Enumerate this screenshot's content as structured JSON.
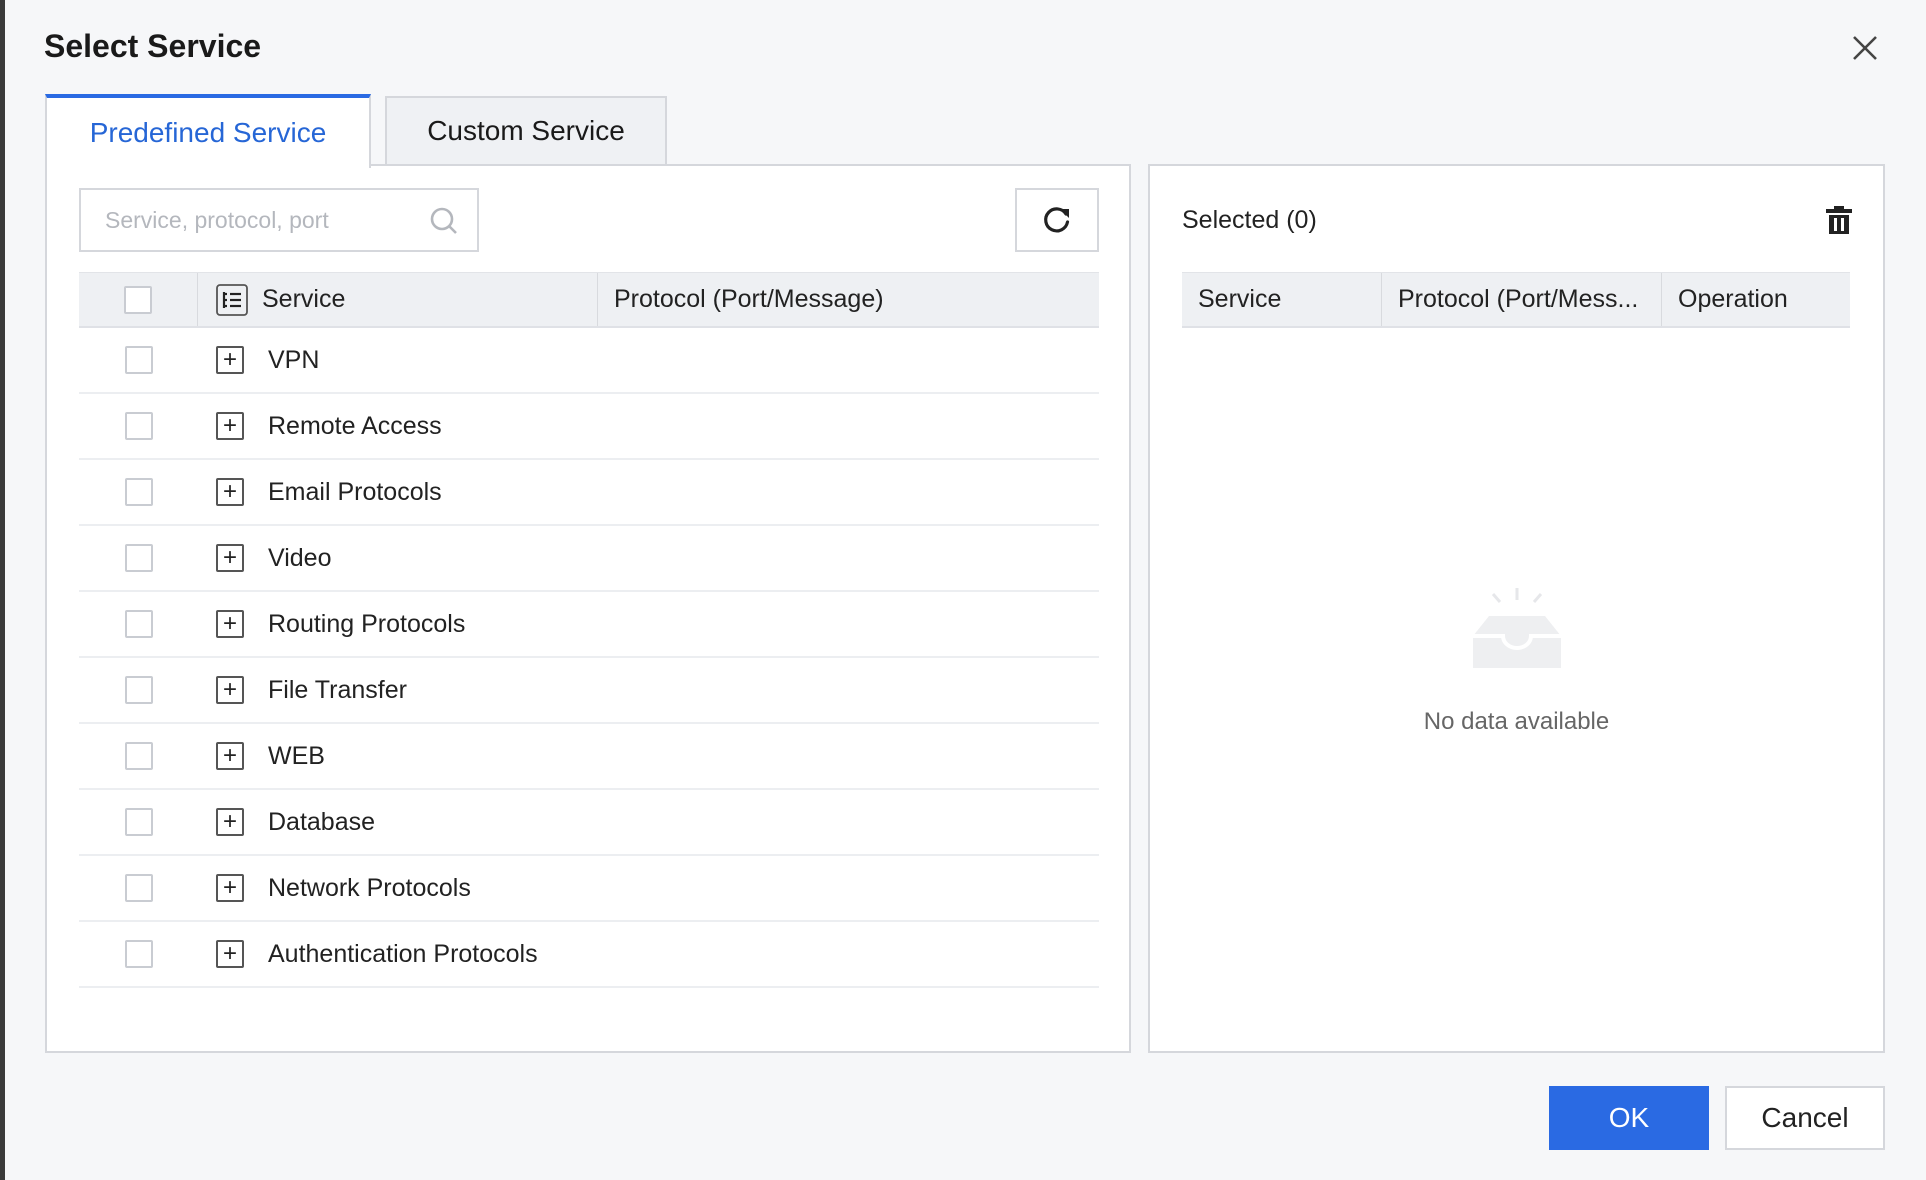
{
  "dialog": {
    "title": "Select Service"
  },
  "tabs": [
    {
      "label": "Predefined Service",
      "active": true
    },
    {
      "label": "Custom Service",
      "active": false
    }
  ],
  "left": {
    "search_placeholder": "Service, protocol, port",
    "columns": {
      "service": "Service",
      "protocol": "Protocol (Port/Message)"
    },
    "rows": [
      {
        "service": "VPN"
      },
      {
        "service": "Remote Access"
      },
      {
        "service": "Email Protocols"
      },
      {
        "service": "Video"
      },
      {
        "service": "Routing Protocols"
      },
      {
        "service": "File Transfer"
      },
      {
        "service": "WEB"
      },
      {
        "service": "Database"
      },
      {
        "service": "Network Protocols"
      },
      {
        "service": "Authentication Protocols"
      }
    ]
  },
  "right": {
    "selected_title": "Selected (0)",
    "columns": {
      "service": "Service",
      "protocol": "Protocol (Port/Mess...",
      "operation": "Operation"
    },
    "empty_text": "No data available"
  },
  "footer": {
    "ok_label": "OK",
    "cancel_label": "Cancel"
  },
  "colors": {
    "accent": "#2a6ae3",
    "active_tab_text": "#2666d6"
  },
  "icons": {
    "close": "close-icon",
    "search": "search-icon",
    "refresh": "refresh-icon",
    "tree": "tree-list-icon",
    "expand": "plus-square-icon",
    "trash": "trash-icon",
    "empty": "empty-box-icon"
  }
}
